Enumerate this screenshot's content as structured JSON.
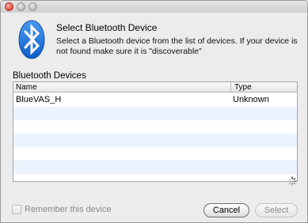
{
  "window": {
    "traffic_lights": [
      "close",
      "minimize",
      "maximize"
    ]
  },
  "header": {
    "title": "Select Bluetooth Device",
    "description": "Select a Bluetooth device from the list of devices. If your device is not found make sure it is \"discoverable\""
  },
  "devices": {
    "section_label": "Bluetooth Devices",
    "columns": [
      "Name",
      "Type"
    ],
    "rows": [
      {
        "name": "BlueVAS_H",
        "type": "Unknown"
      }
    ],
    "empty_row_count": 6
  },
  "footer": {
    "remember_label": "Remember this device",
    "remember_checked": false,
    "cancel_label": "Cancel",
    "select_label": "Select",
    "select_enabled": false
  },
  "colors": {
    "bluetooth_blue": "#1e6fd9",
    "alt_row": "#edf3fe"
  },
  "icons": {
    "bluetooth": "bluetooth-icon",
    "spinner": "spinner-icon"
  }
}
